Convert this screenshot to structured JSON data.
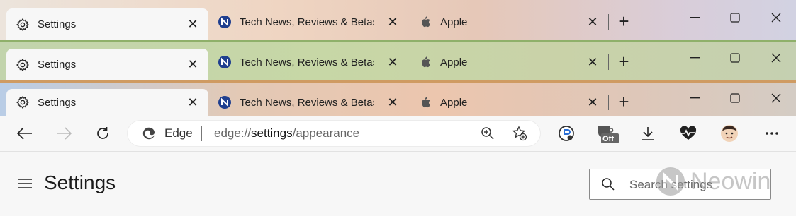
{
  "tab_strips": [
    {
      "tabs": [
        {
          "label": "Settings",
          "icon": "gear-icon",
          "active": true
        },
        {
          "label": "Tech News, Reviews & Betas | Neowin",
          "icon": "neowin-icon",
          "active": false
        },
        {
          "label": "Apple",
          "icon": "apple-icon",
          "active": false
        }
      ]
    },
    {
      "tabs": [
        {
          "label": "Settings",
          "icon": "gear-icon",
          "active": true
        },
        {
          "label": "Tech News, Reviews & Betas | Neowin",
          "icon": "neowin-icon",
          "active": false
        },
        {
          "label": "Apple",
          "icon": "apple-icon",
          "active": false
        }
      ]
    },
    {
      "tabs": [
        {
          "label": "Settings",
          "icon": "gear-icon",
          "active": true
        },
        {
          "label": "Tech News, Reviews & Betas | Neowin",
          "icon": "neowin-icon",
          "active": false
        },
        {
          "label": "Apple",
          "icon": "apple-icon",
          "active": false
        }
      ]
    }
  ],
  "address_bar": {
    "site_label": "Edge",
    "url_scheme": "edge://",
    "url_host": "settings",
    "url_path": "/appearance"
  },
  "extension_badge": "Off",
  "page": {
    "title": "Settings",
    "search_placeholder": "Search settings"
  },
  "watermark": {
    "text": "Neowin"
  },
  "colors": {
    "accent": "#1b1b1b",
    "neowin_blue": "#1f3f8f"
  }
}
